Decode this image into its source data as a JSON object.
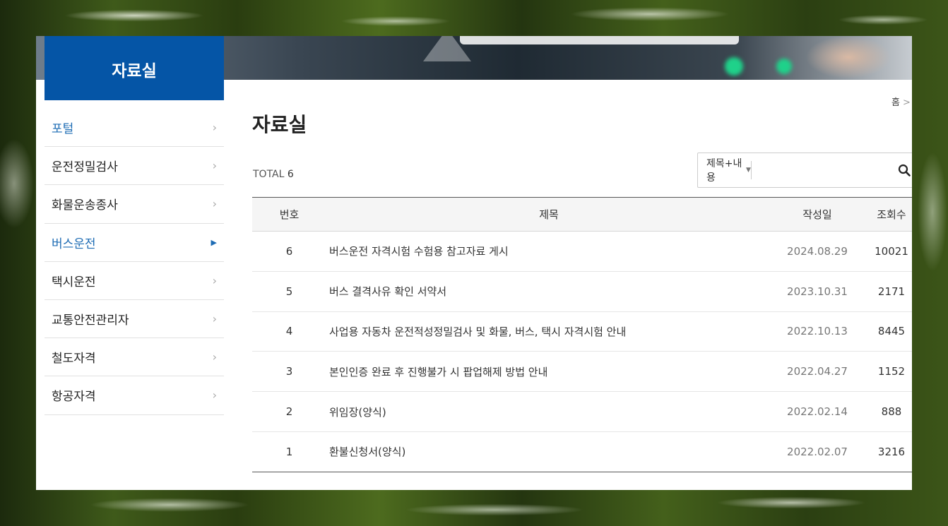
{
  "sidebar": {
    "title": "자료실",
    "items": [
      {
        "label": "포털"
      },
      {
        "label": "운전정밀검사"
      },
      {
        "label": "화물운송종사"
      },
      {
        "label": "버스운전"
      },
      {
        "label": "택시운전"
      },
      {
        "label": "교통안전관리자"
      },
      {
        "label": "철도자격"
      },
      {
        "label": "항공자격"
      }
    ]
  },
  "breadcrumb": {
    "home": "홈",
    "separator": ">"
  },
  "page": {
    "title": "자료실",
    "total_label": "TOTAL",
    "total_count": "6"
  },
  "search": {
    "select_value": "제목+내용",
    "input_value": "",
    "placeholder": ""
  },
  "table": {
    "headers": {
      "no": "번호",
      "title": "제목",
      "date": "작성일",
      "views": "조회수"
    },
    "rows": [
      {
        "no": "6",
        "title": "버스운전 자격시험 수험용 참고자료 게시",
        "date": "2024.08.29",
        "views": "10021"
      },
      {
        "no": "5",
        "title": "버스 결격사유 확인 서약서",
        "date": "2023.10.31",
        "views": "2171"
      },
      {
        "no": "4",
        "title": "사업용 자동차 운전적성정밀검사 및 화물, 버스, 택시 자격시험 안내",
        "date": "2022.10.13",
        "views": "8445"
      },
      {
        "no": "3",
        "title": "본인인증 완료 후 진행불가 시 팝업해제 방법 안내",
        "date": "2022.04.27",
        "views": "1152"
      },
      {
        "no": "2",
        "title": "위임장(양식)",
        "date": "2022.02.14",
        "views": "888"
      },
      {
        "no": "1",
        "title": "환불신청서(양식)",
        "date": "2022.02.07",
        "views": "3216"
      }
    ]
  },
  "colors": {
    "brand_blue": "#0555a6",
    "active_text": "#1e6cb4"
  }
}
